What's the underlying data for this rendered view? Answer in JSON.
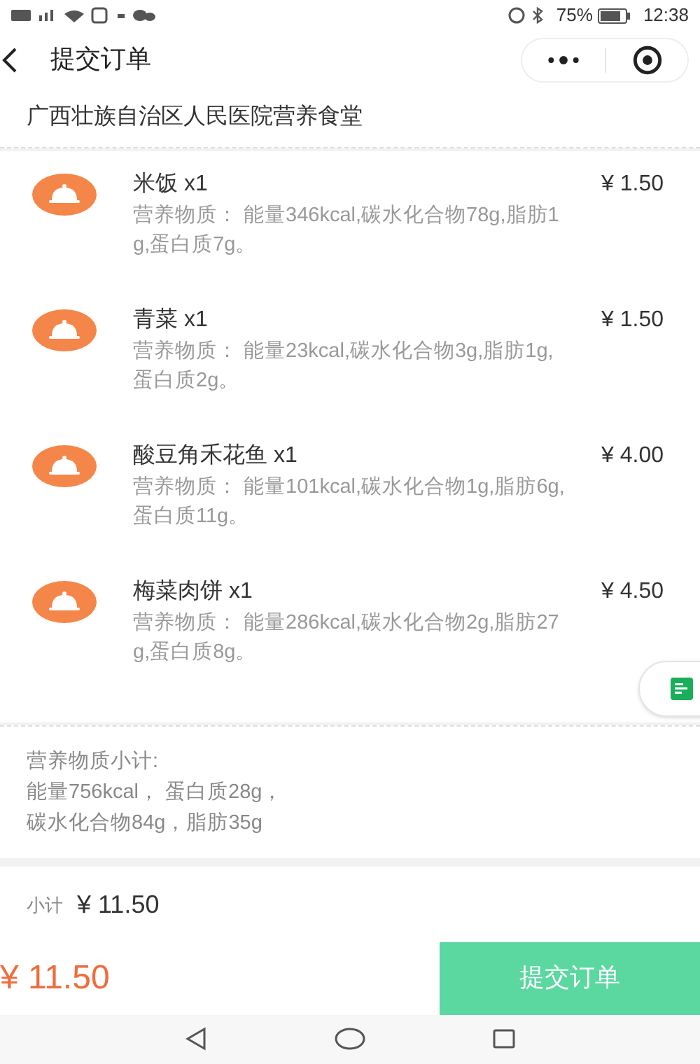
{
  "status_bar": {
    "battery_percent": "75%",
    "time": "12:38"
  },
  "header": {
    "title": "提交订单"
  },
  "canteen": "广西壮族自治区人民医院营养食堂",
  "items": [
    {
      "name": "米饭 x1",
      "price": "¥ 1.50",
      "nutrition": "营养物质： 能量346kcal,碳水化合物78g,脂肪1g,蛋白质7g。"
    },
    {
      "name": "青菜 x1",
      "price": "¥ 1.50",
      "nutrition": "营养物质： 能量23kcal,碳水化合物3g,脂肪1g,蛋白质2g。"
    },
    {
      "name": "酸豆角禾花鱼 x1",
      "price": "¥ 4.00",
      "nutrition": "营养物质： 能量101kcal,碳水化合物1g,脂肪6g,蛋白质11g。"
    },
    {
      "name": "梅菜肉饼 x1",
      "price": "¥ 4.50",
      "nutrition": "营养物质： 能量286kcal,碳水化合物2g,脂肪27g,蛋白质8g。"
    }
  ],
  "nutrition_summary": {
    "title": "营养物质小计:",
    "lines": [
      "能量756kcal， 蛋白质28g，",
      "碳水化合物84g，脂肪35g"
    ]
  },
  "subtotal": {
    "label": "小计",
    "amount": "¥ 11.50"
  },
  "footer": {
    "total": "¥ 11.50",
    "submit": "提交订单"
  }
}
